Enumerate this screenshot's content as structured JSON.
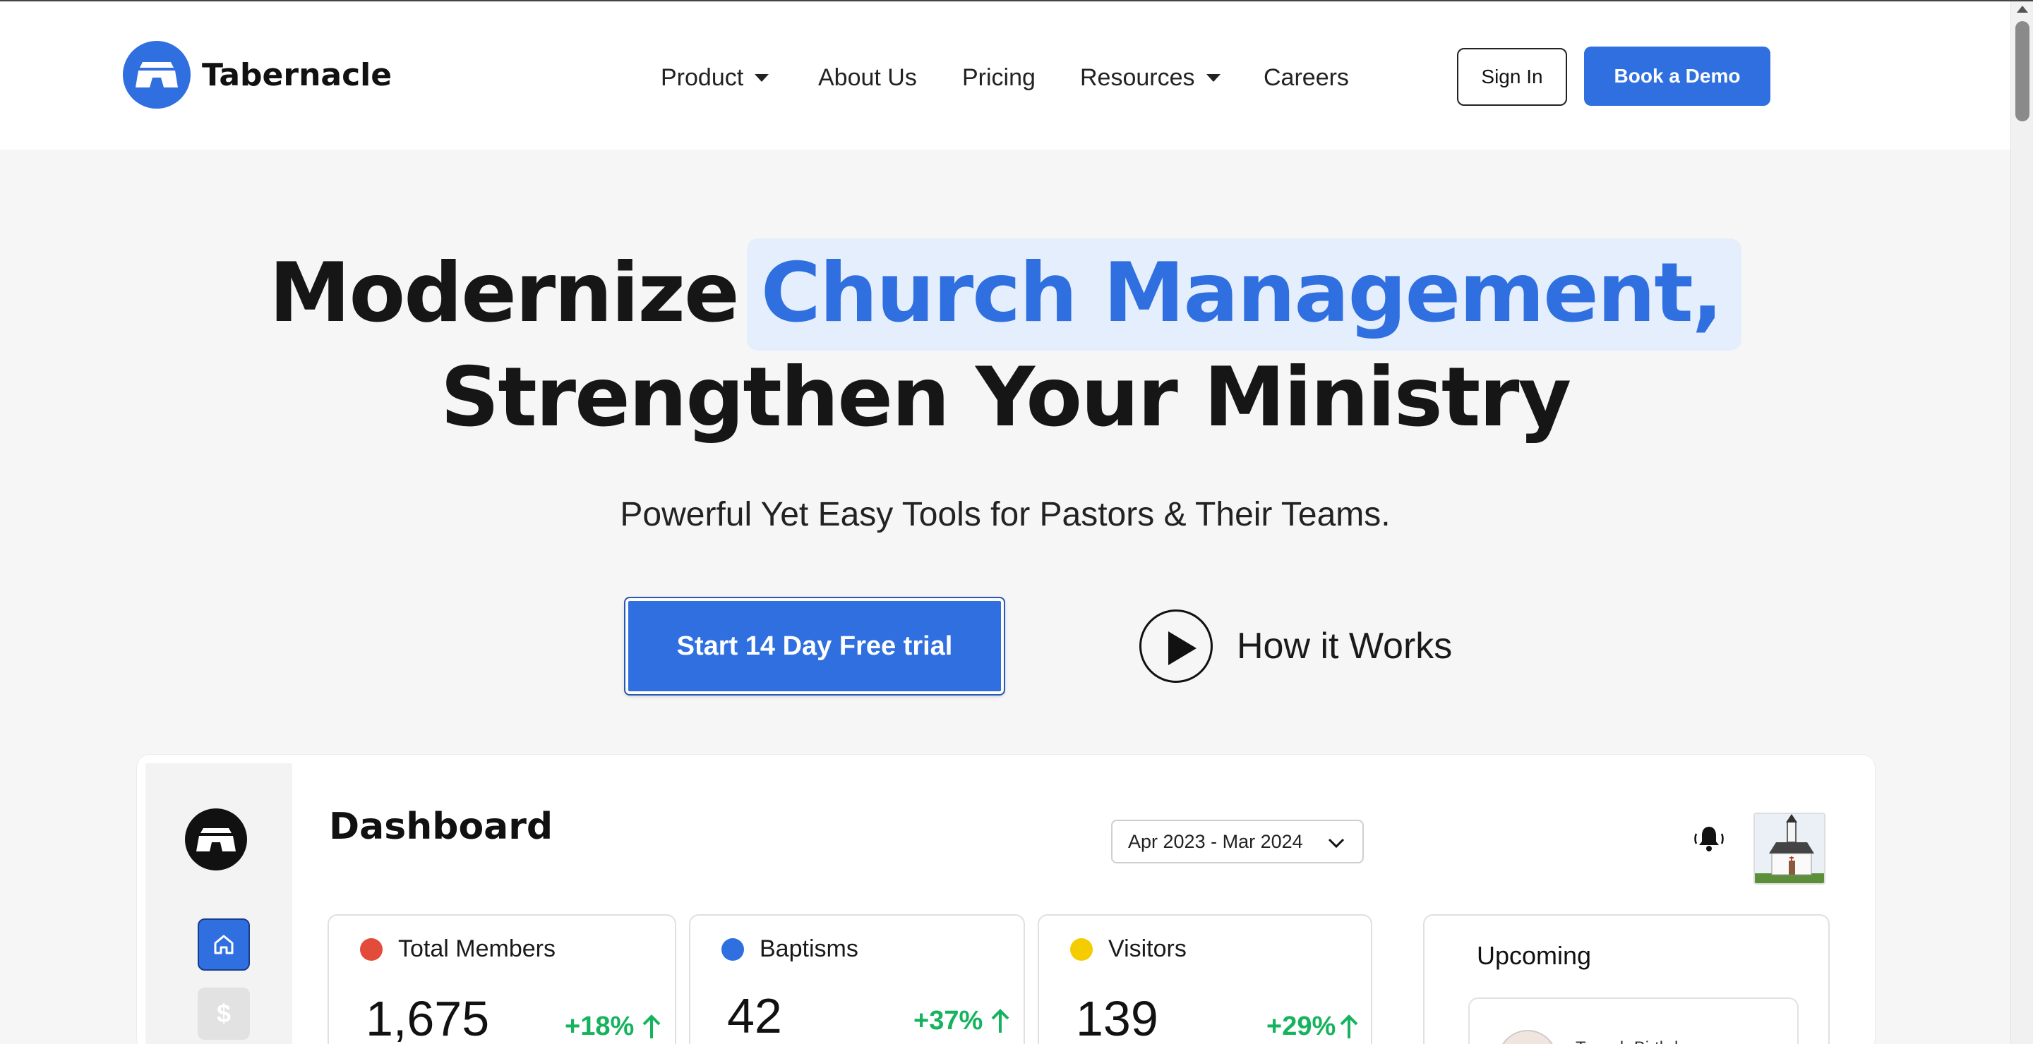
{
  "brand": {
    "name": "Tabernacle",
    "accent": "#2f6fe0"
  },
  "nav": {
    "items": [
      {
        "label": "Product",
        "has_dropdown": true
      },
      {
        "label": "About Us",
        "has_dropdown": false
      },
      {
        "label": "Pricing",
        "has_dropdown": false
      },
      {
        "label": "Resources",
        "has_dropdown": true
      },
      {
        "label": "Careers",
        "has_dropdown": false
      }
    ],
    "sign_in": "Sign In",
    "book_demo": "Book a Demo"
  },
  "hero": {
    "headline_part1": "Modernize",
    "headline_highlight": "Church Management,",
    "headline_line2": "Strengthen Your Ministry",
    "subtitle": "Powerful Yet Easy Tools for Pastors & Their Teams.",
    "cta_trial": "Start 14 Day Free trial",
    "how_it_works": "How it Works"
  },
  "dashboard": {
    "title": "Dashboard",
    "date_range": "Apr 2023 - Mar 2024",
    "dollar_glyph": "$",
    "stats": [
      {
        "label": "Total Members",
        "value": "1,675",
        "delta": "+18%",
        "dot_color": "#e34b3b"
      },
      {
        "label": "Baptisms",
        "value": "42",
        "delta": "+37%",
        "dot_color": "#2f6fe0"
      },
      {
        "label": "Visitors",
        "value": "139",
        "delta": "+29%",
        "dot_color": "#f5cc00"
      }
    ],
    "upcoming": {
      "title": "Upcoming",
      "first_item_name": "Tessah Birthday"
    }
  },
  "icons": {
    "nav_dropdown": "caret-down-icon",
    "play": "play-icon",
    "home": "home-icon",
    "dollar": "dollar-icon",
    "bell": "bell-icon",
    "chevron": "chevron-down-icon",
    "trend": "arrow-up-icon"
  }
}
